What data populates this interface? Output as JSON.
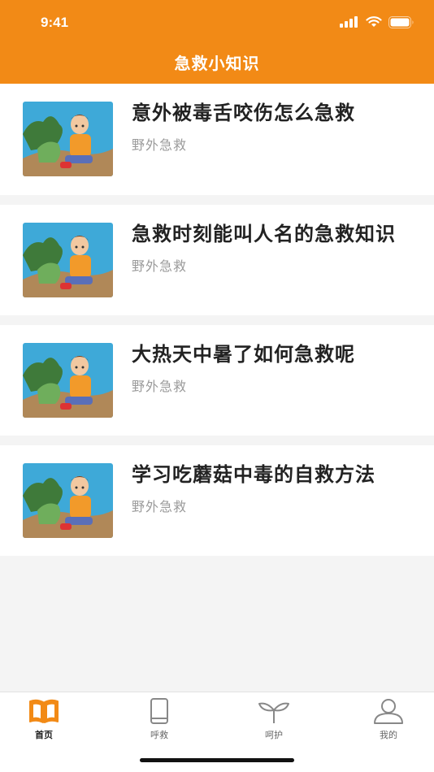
{
  "status_bar": {
    "time": "9:41"
  },
  "header": {
    "title": "急救小知识"
  },
  "articles": [
    {
      "title": "意外被毒舌咬伤怎么急救",
      "category": "野外急救"
    },
    {
      "title": "急救时刻能叫人名的急救知识",
      "category": "野外急救"
    },
    {
      "title": "大热天中暑了如何急救呢",
      "category": "野外急救"
    },
    {
      "title": "学习吃蘑菇中毒的自救方法",
      "category": "野外急救"
    }
  ],
  "tabbar": {
    "tabs": [
      {
        "label": "首页",
        "icon": "book-icon",
        "active": true
      },
      {
        "label": "呼救",
        "icon": "phone-icon",
        "active": false
      },
      {
        "label": "呵护",
        "icon": "sprout-icon",
        "active": false
      },
      {
        "label": "我的",
        "icon": "user-icon",
        "active": false
      }
    ]
  },
  "colors": {
    "brand": "#f28a16",
    "active_tab": "#f28a16",
    "inactive_tab": "#888888"
  }
}
